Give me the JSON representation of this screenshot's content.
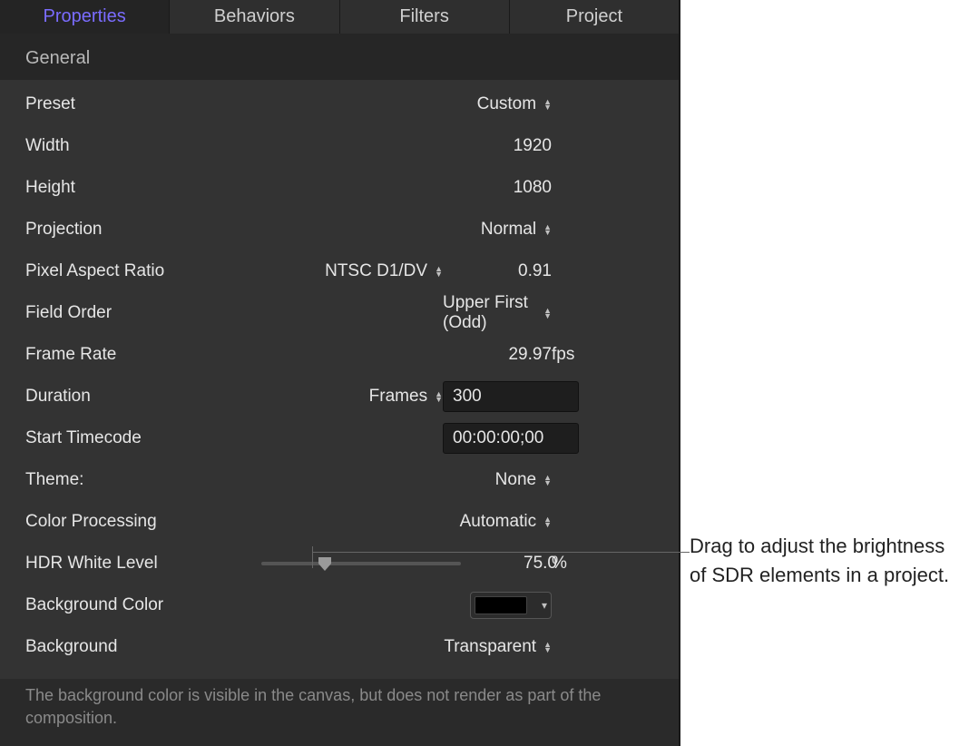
{
  "tabs": {
    "properties": "Properties",
    "behaviors": "Behaviors",
    "filters": "Filters",
    "project": "Project"
  },
  "section": {
    "general": "General"
  },
  "rows": {
    "preset": {
      "label": "Preset",
      "value": "Custom"
    },
    "width": {
      "label": "Width",
      "value": "1920"
    },
    "height": {
      "label": "Height",
      "value": "1080"
    },
    "projection": {
      "label": "Projection",
      "value": "Normal"
    },
    "pixelAspect": {
      "label": "Pixel Aspect Ratio",
      "value": "NTSC D1/DV",
      "numeric": "0.91"
    },
    "fieldOrder": {
      "label": "Field Order",
      "value": "Upper First (Odd)"
    },
    "frameRate": {
      "label": "Frame Rate",
      "value": "29.97",
      "unit": "fps"
    },
    "duration": {
      "label": "Duration",
      "mode": "Frames",
      "value": "300"
    },
    "startTimecode": {
      "label": "Start Timecode",
      "value": "00:00:00;00"
    },
    "theme": {
      "label": "Theme:",
      "value": "None"
    },
    "colorProcessing": {
      "label": "Color Processing",
      "value": "Automatic"
    },
    "hdrWhiteLevel": {
      "label": "HDR White Level",
      "value": "75.0",
      "unit": "%"
    },
    "backgroundColor": {
      "label": "Background Color",
      "swatch": "#000000"
    },
    "background": {
      "label": "Background",
      "value": "Transparent"
    }
  },
  "hint": "The background color is visible in the canvas, but does not render as part of the composition.",
  "callout": "Drag to adjust the brightness of SDR elements in a project."
}
